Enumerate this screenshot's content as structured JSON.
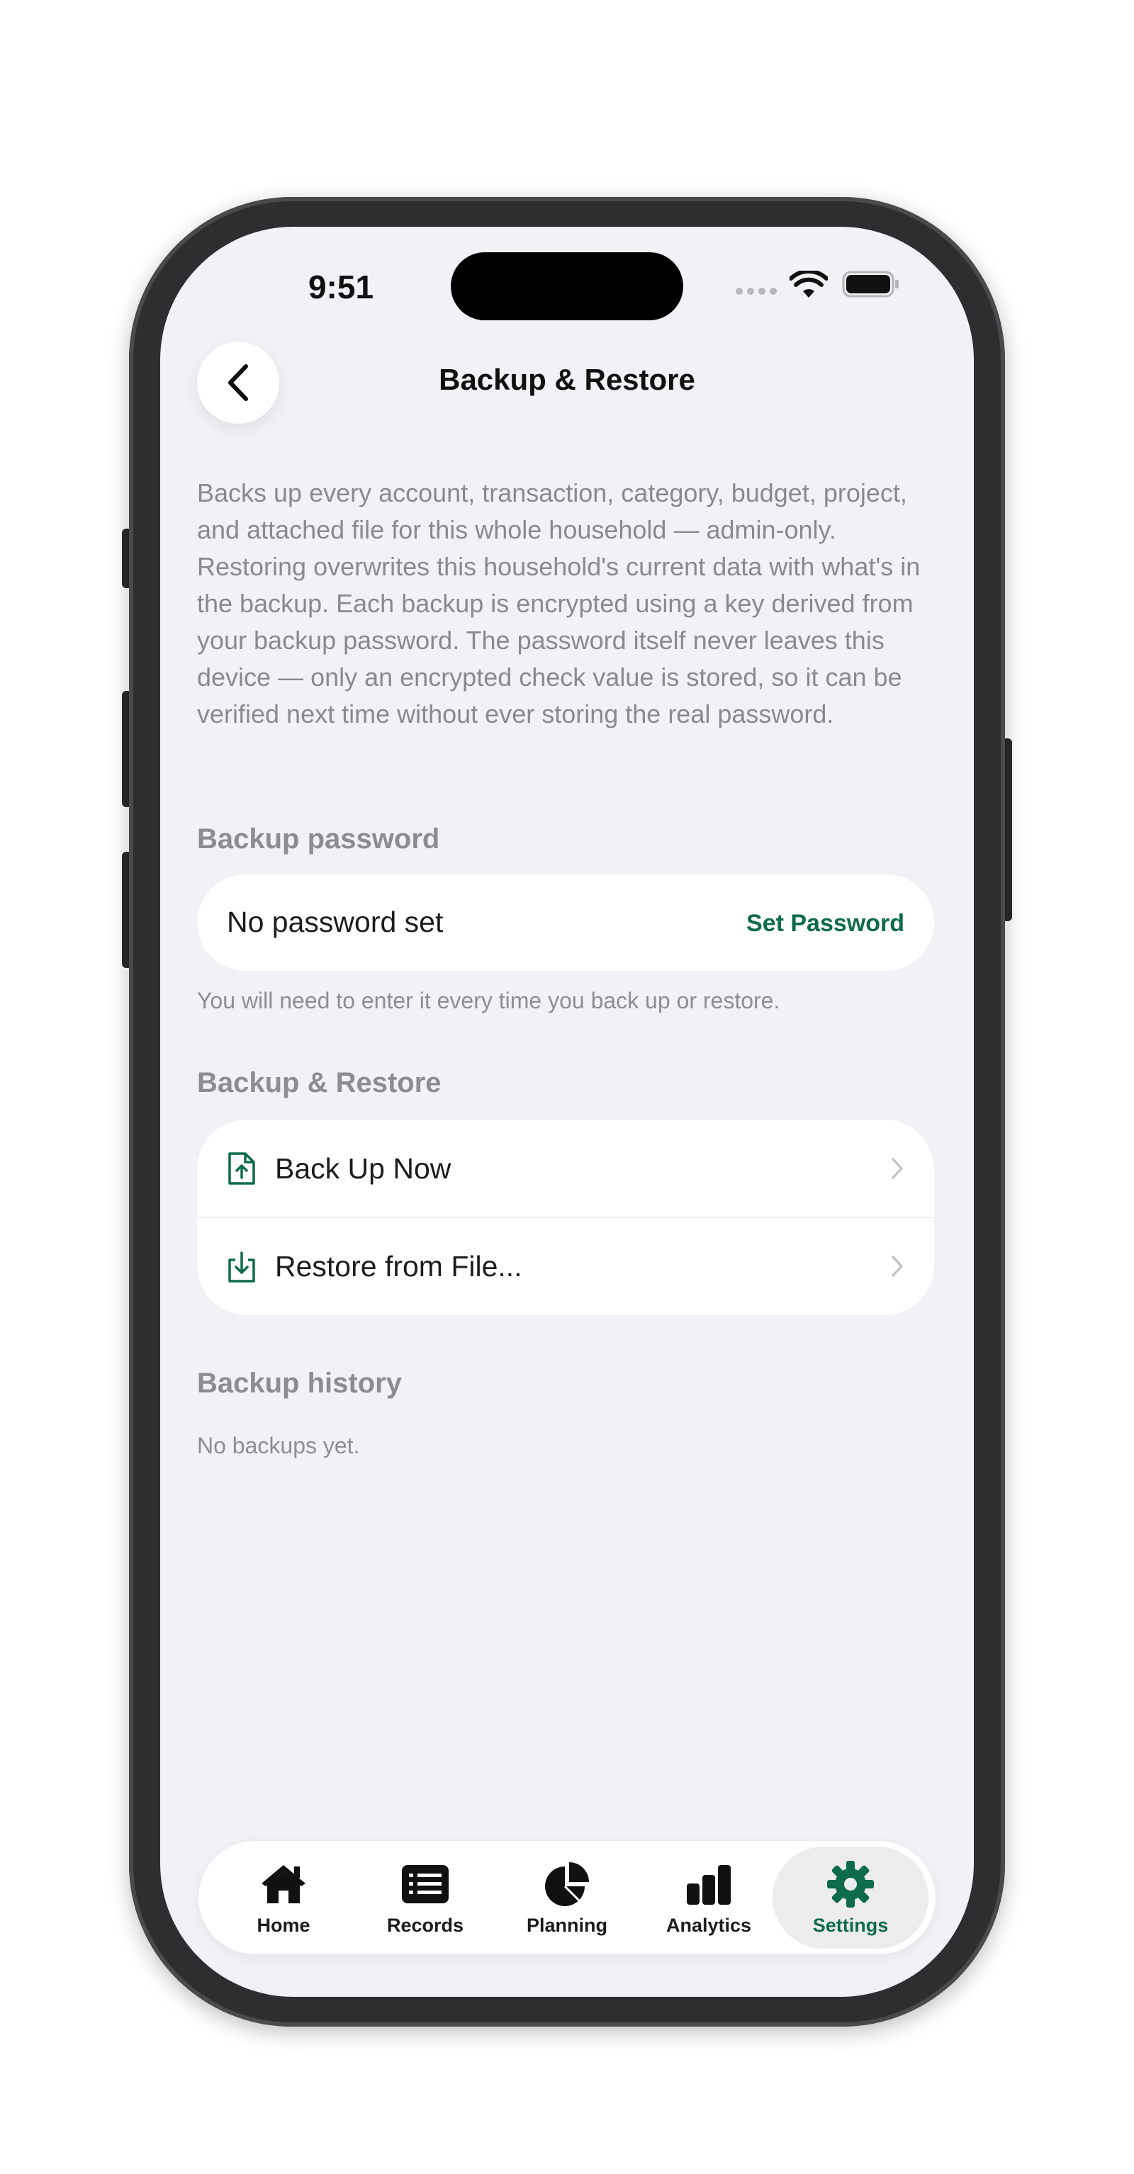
{
  "status_bar": {
    "time": "9:51"
  },
  "header": {
    "title": "Backup & Restore"
  },
  "description": "Backs up every account, transaction, category, budget, project, and attached file for this whole household — admin-only. Restoring overwrites this household's current data with what's in the backup. Each backup is encrypted using a key derived from your backup password. The password itself never leaves this device — only an encrypted check value is stored, so it can be verified next time without ever storing the real password.",
  "password_section": {
    "header": "Backup password",
    "status": "No password set",
    "action_label": "Set Password",
    "footnote": "You will need to enter it every time you back up or restore."
  },
  "backup_section": {
    "header": "Backup & Restore",
    "items": [
      {
        "label": "Back Up Now",
        "icon": "file-upload-icon"
      },
      {
        "label": "Restore from File...",
        "icon": "download-tray-icon"
      }
    ]
  },
  "history_section": {
    "header": "Backup history",
    "empty_text": "No backups yet."
  },
  "tab_bar": {
    "tabs": [
      {
        "label": "Home",
        "icon": "home-icon"
      },
      {
        "label": "Records",
        "icon": "list-icon"
      },
      {
        "label": "Planning",
        "icon": "pie-chart-icon"
      },
      {
        "label": "Analytics",
        "icon": "bar-chart-icon"
      },
      {
        "label": "Settings",
        "icon": "gear-icon"
      }
    ],
    "active": "Settings"
  },
  "colors": {
    "accent": "#0e6b4c",
    "background": "#f1f1f6",
    "secondary_text": "#8a8a8e"
  }
}
